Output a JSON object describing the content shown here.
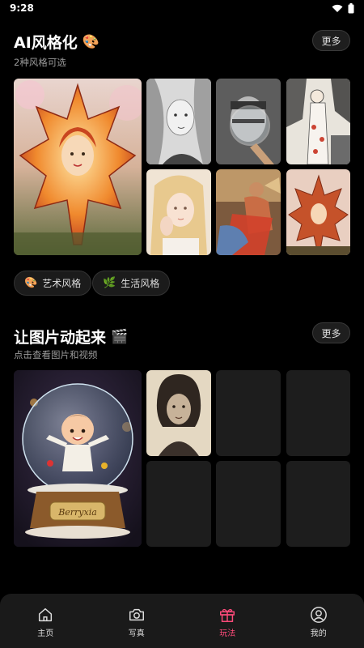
{
  "status": {
    "time": "9:28"
  },
  "section1": {
    "title": "AI风格化",
    "emoji": "🎨",
    "subtitle": "2种风格可选",
    "more_label": "更多",
    "chips": [
      {
        "icon": "🎨",
        "label": "艺术风格"
      },
      {
        "icon": "🌿",
        "label": "生活风格"
      }
    ]
  },
  "section2": {
    "title": "让图片动起来",
    "emoji": "🎬",
    "subtitle": "点击查看图片和视频",
    "more_label": "更多",
    "globe_text": "Berryxia"
  },
  "nav": [
    {
      "label": "主页",
      "icon": "home-icon"
    },
    {
      "label": "写真",
      "icon": "camera-icon"
    },
    {
      "label": "玩法",
      "icon": "gift-icon",
      "active": true
    },
    {
      "label": "我的",
      "icon": "profile-icon"
    }
  ],
  "colors": {
    "accent": "#ff4b7a",
    "background": "#000000",
    "nav_bg": "#1a1a1a"
  }
}
